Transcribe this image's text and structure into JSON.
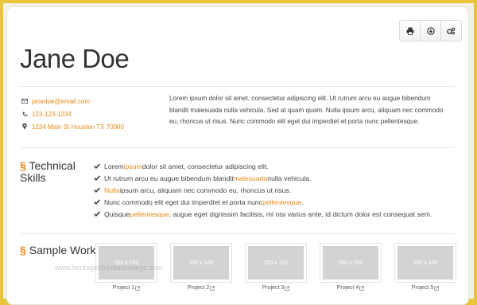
{
  "toolbar": {
    "buttons": [
      {
        "icon": "print-icon"
      },
      {
        "icon": "download-icon"
      },
      {
        "icon": "settings-icon"
      }
    ]
  },
  "header": {
    "name": "Jane Doe"
  },
  "contact": {
    "email": "janedoe@email.com",
    "phone": "123-123-1234",
    "address": "1234 Main St Houston TX 70000"
  },
  "intro": "Lorem ipsum dolor sit amet, consectetur adipiscing elit. Ut rutrum arcu eu augue bibendum blandit malesuada nulla vehicula. Sed at quam quam. Nulla ipsum arcu, aliquam nec commodo eu, rhoncus ut risus. Nunc commodo elit eget dui imperdiet et porta nunc pellentesque.",
  "skills_section": {
    "symbol": "§",
    "title_line1": "Technical",
    "title_line2": "Skills",
    "items": [
      {
        "pre": "Lorem ",
        "hl": "ipsum",
        "post": " dolor sit amet, consectetur adipiscing elit."
      },
      {
        "pre": "Ut rutrum arcu eu augue bibendum blandit ",
        "hl": "malesuada",
        "post": " nulla vehicula."
      },
      {
        "pre": "",
        "hl": "Nulla",
        "post": " ipsum arcu, aliquam nec commodo eu, rhoncus ut risus."
      },
      {
        "pre": "Nunc commodo elit eget dui imperdiet et porta nunc ",
        "hl": "pellentesque",
        "post": "."
      },
      {
        "pre": "Quisque ",
        "hl": "pellentesque",
        "post": ", augue eget dignissim facilisis, mi nisi varius ante, id dictum dolor est consequat sem."
      }
    ]
  },
  "work_section": {
    "symbol": "§",
    "title": "Sample Work",
    "projects": [
      {
        "thumb": "200 x 100",
        "label": "Project 1"
      },
      {
        "thumb": "200 x 100",
        "label": "Project 2"
      },
      {
        "thumb": "200 x 100",
        "label": "Project 3"
      },
      {
        "thumb": "200 x 100",
        "label": "Project 4"
      },
      {
        "thumb": "200 x 100",
        "label": "Project 5"
      }
    ]
  },
  "watermark": "www.heritagechristiancollege.com"
}
